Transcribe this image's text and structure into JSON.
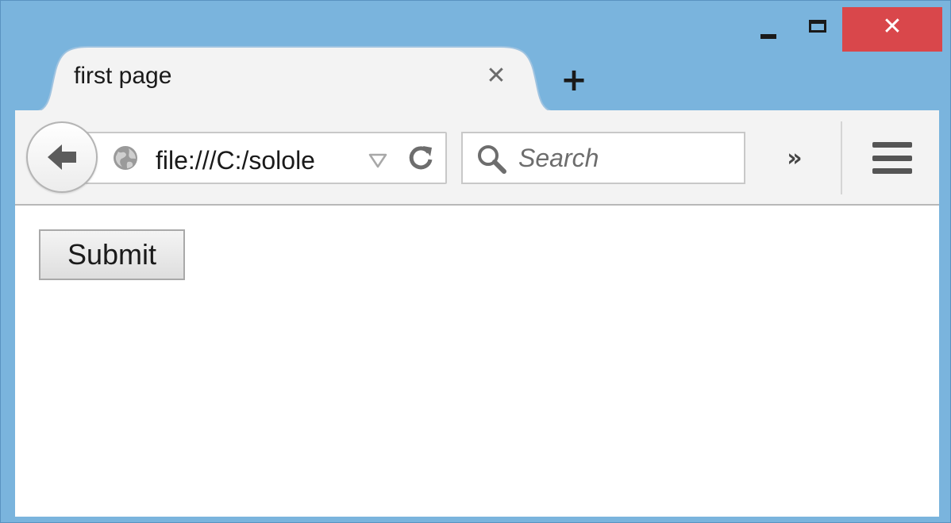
{
  "window": {
    "frame_color": "#7ab4dd",
    "close_color": "#d9474b",
    "controls": {
      "minimize_icon": "minimize-icon",
      "maximize_icon": "maximize-icon",
      "close_icon": "close-icon",
      "close_glyph": "✕"
    }
  },
  "tabs": [
    {
      "title": "first page",
      "close_glyph": "✕",
      "active": true
    }
  ],
  "new_tab": {
    "glyph": "+"
  },
  "toolbar": {
    "back_icon": "back-arrow-icon",
    "url": "file:///C:/solole",
    "site_icon": "globe-icon",
    "dropdown_icon": "dropdown-triangle-icon",
    "reload_icon": "reload-icon",
    "search": {
      "placeholder": "Search",
      "value": ""
    },
    "overflow_glyph": "»",
    "menu_icon": "hamburger-menu-icon"
  },
  "page": {
    "submit_label": "Submit"
  }
}
